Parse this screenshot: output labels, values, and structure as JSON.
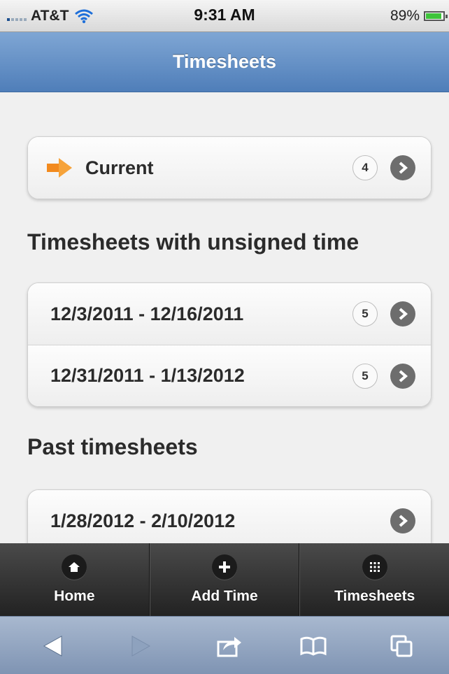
{
  "status_bar": {
    "carrier": "AT&T",
    "time": "9:31 AM",
    "battery": "89%",
    "battery_level": 0.89
  },
  "header": {
    "title": "Timesheets"
  },
  "current": {
    "label": "Current",
    "count": "4"
  },
  "unsigned_section": {
    "title": "Timesheets with unsigned time",
    "items": [
      {
        "label": "12/3/2011 - 12/16/2011",
        "count": "5"
      },
      {
        "label": "12/31/2011 - 1/13/2012",
        "count": "5"
      }
    ]
  },
  "past_section": {
    "title": "Past timesheets",
    "items": [
      {
        "label": "1/28/2012 - 2/10/2012"
      }
    ]
  },
  "tabbar": {
    "tabs": [
      {
        "label": "Home",
        "icon": "home-icon"
      },
      {
        "label": "Add Time",
        "icon": "plus-icon"
      },
      {
        "label": "Timesheets",
        "icon": "grid-icon"
      }
    ]
  },
  "browser_toolbar": {
    "buttons": [
      "back-icon",
      "forward-icon",
      "share-icon",
      "bookmarks-icon",
      "tabs-icon"
    ]
  },
  "colors": {
    "header": "#5e88c0",
    "accent_arrow": "#f28a1e",
    "tabbar": "#333333",
    "toolbar": "#91a4bf"
  }
}
